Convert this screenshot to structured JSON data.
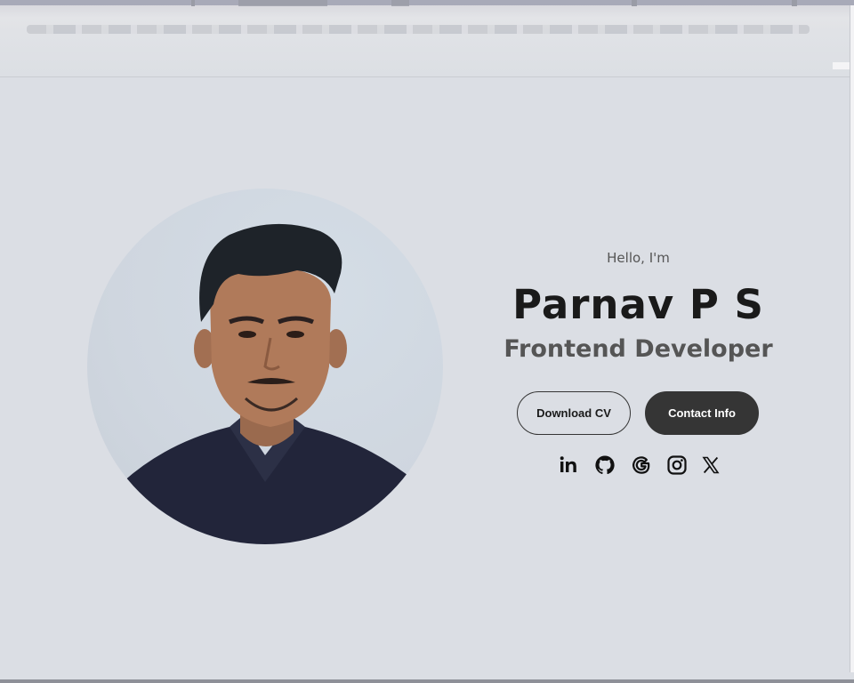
{
  "hero": {
    "greeting": "Hello, I'm",
    "name": "Parnav P S",
    "role": "Frontend Developer"
  },
  "buttons": {
    "download_cv": "Download CV",
    "contact_info": "Contact Info"
  },
  "socials": [
    {
      "icon": "linkedin-icon"
    },
    {
      "icon": "github-icon"
    },
    {
      "icon": "google-icon"
    },
    {
      "icon": "instagram-icon"
    },
    {
      "icon": "x-twitter-icon"
    }
  ],
  "colors": {
    "background": "#dbdee4",
    "dark_button": "#353535",
    "name_text": "#1a1a1a",
    "subtitle_text": "#555555"
  }
}
